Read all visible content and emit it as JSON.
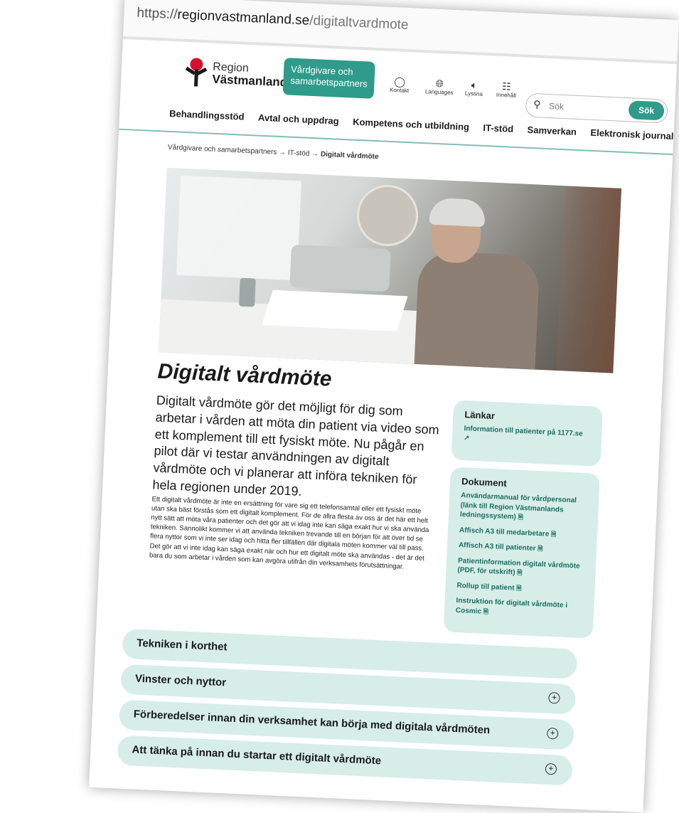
{
  "browser": {
    "url_scheme": "https://",
    "url_host": "regionvastmanland.se",
    "url_path": "/digitaltvardmote"
  },
  "header": {
    "logo_line1": "Region",
    "logo_line2": "Västmanland",
    "audience_button": "Vårdgivare och samarbetspartners",
    "utilities": [
      {
        "label": "Kontakt",
        "icon": "speech-bubble-icon"
      },
      {
        "label": "Languages",
        "icon": "globe-icon"
      },
      {
        "label": "Lyssna",
        "icon": "speaker-icon"
      },
      {
        "label": "Innehåll",
        "icon": "sitemap-icon"
      }
    ],
    "search_placeholder": "Sök",
    "search_button": "Sök"
  },
  "nav": {
    "items": [
      "Behandlingsstöd",
      "Avtal och uppdrag",
      "Kompetens och utbildning",
      "IT-stöd",
      "Samverkan",
      "Elektronisk journal"
    ]
  },
  "breadcrumb": {
    "part1": "Vårdgivare och samarbetspartners",
    "sep": "→",
    "part2": "IT-stöd",
    "current": "Digitalt vårdmöte"
  },
  "article": {
    "title": "Digitalt vårdmöte",
    "lead": "Digitalt vårdmöte gör det möjligt för dig som arbetar i vården att möta din patient via video som ett komplement till ett fysiskt möte. Nu pågår en pilot där vi testar användningen av digitalt vårdmöte och vi planerar att införa tekniken för hela regionen under 2019.",
    "body": "Ett digitalt vårdmöte är inte en ersättning för vare sig ett telefonsamtal eller ett fysiskt möte utan ska bäst förstås som ett digitalt komplement. För de allra flesta av oss är det här ett helt nytt sätt att möta våra patienter och det gör att vi idag inte kan säga exakt hur vi ska använda tekniken. Sannolikt kommer vi att använda tekniken trevande till en början för att över tid se flera nyttor som vi inte ser idag och hitta fler tillfällen där digitala möten kommer väl till pass. Det gör att vi inte idag kan säga exakt när och hur ett digitalt möte ska användas - det är det bara du som arbetar i vården som kan avgöra utifrån din verksamhets förutsättningar."
  },
  "links_box": {
    "title": "Länkar",
    "items": [
      "Information till patienter på 1177.se"
    ]
  },
  "docs_box": {
    "title": "Dokument",
    "items": [
      "Användarmanual för vårdpersonal (länk till Region Västmanlands ledningssystem)",
      "Affisch A3 till medarbetare",
      "Affisch A3 till patienter",
      "Patientinformation digitalt vårdmöte (PDF, för utskrift)",
      "Rollup till patient",
      "Instruktion för digitalt vårdmöte i Cosmic"
    ]
  },
  "accordions": [
    "Tekniken i korthet",
    "Vinster och nyttor",
    "Förberedelser innan din verksamhet kan börja med digitala vårdmöten",
    "Att tänka på innan du startar ett digitalt vårdmöte"
  ],
  "colors": {
    "accent": "#2f9b8a",
    "panel": "#d6ede8",
    "logo_red": "#d6112b"
  }
}
